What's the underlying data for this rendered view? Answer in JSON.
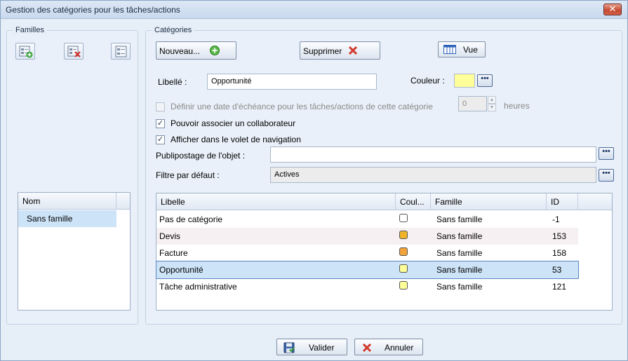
{
  "window": {
    "title": "Gestion des catégories pour les tâches/actions",
    "close": "✕"
  },
  "families": {
    "group_label": "Familles",
    "tools": [
      "add-family-icon",
      "delete-family-icon",
      "edit-family-icon"
    ],
    "grid": {
      "header": "Nom",
      "rows": [
        "Sans famille"
      ]
    }
  },
  "categories": {
    "group_label": "Catégories",
    "buttons": {
      "new": "Nouveau...",
      "delete": "Supprimer",
      "view": "Vue"
    },
    "label_field": {
      "label": "Libellé :",
      "value": "Opportunité"
    },
    "color_field": {
      "label": "Couleur :",
      "value": "#ffff99",
      "dots": "•••"
    },
    "due_date": {
      "label": "Définir une date d'échéance pour les tâches/actions de cette catégorie",
      "checked": false,
      "value": "0",
      "unit": "heures"
    },
    "collaborator": {
      "label": "Pouvoir associer un collaborateur",
      "checked": true,
      "mark": "✓"
    },
    "navigation": {
      "label": "Afficher dans le volet de navigation",
      "checked": true,
      "mark": "✓"
    },
    "mailing": {
      "label": "Publipostage de l'objet :",
      "value": "",
      "dots": "•••"
    },
    "filter": {
      "label": "Filtre par défaut :",
      "value": "Actives",
      "dots": "•••"
    },
    "grid": {
      "headers": [
        "Libelle",
        "Coul...",
        "Famille",
        "ID"
      ],
      "rows": [
        {
          "libelle": "Pas de catégorie",
          "color": "#ffffff",
          "famille": "Sans famille",
          "id": "-1"
        },
        {
          "libelle": "Devis",
          "color": "#f0b429",
          "famille": "Sans famille",
          "id": "153"
        },
        {
          "libelle": "Facture",
          "color": "#f2a33a",
          "famille": "Sans famille",
          "id": "158"
        },
        {
          "libelle": "Opportunité",
          "color": "#ffff99",
          "famille": "Sans famille",
          "id": "53"
        },
        {
          "libelle": "Tâche administrative",
          "color": "#ffff99",
          "famille": "Sans famille",
          "id": "121"
        }
      ],
      "selected_index": 3
    }
  },
  "footer": {
    "ok": "Valider",
    "cancel": "Annuler"
  },
  "colors": {
    "selection": "#cde3f7",
    "selection_border": "#5b86c2",
    "alt_row": "#f6f0f2"
  }
}
